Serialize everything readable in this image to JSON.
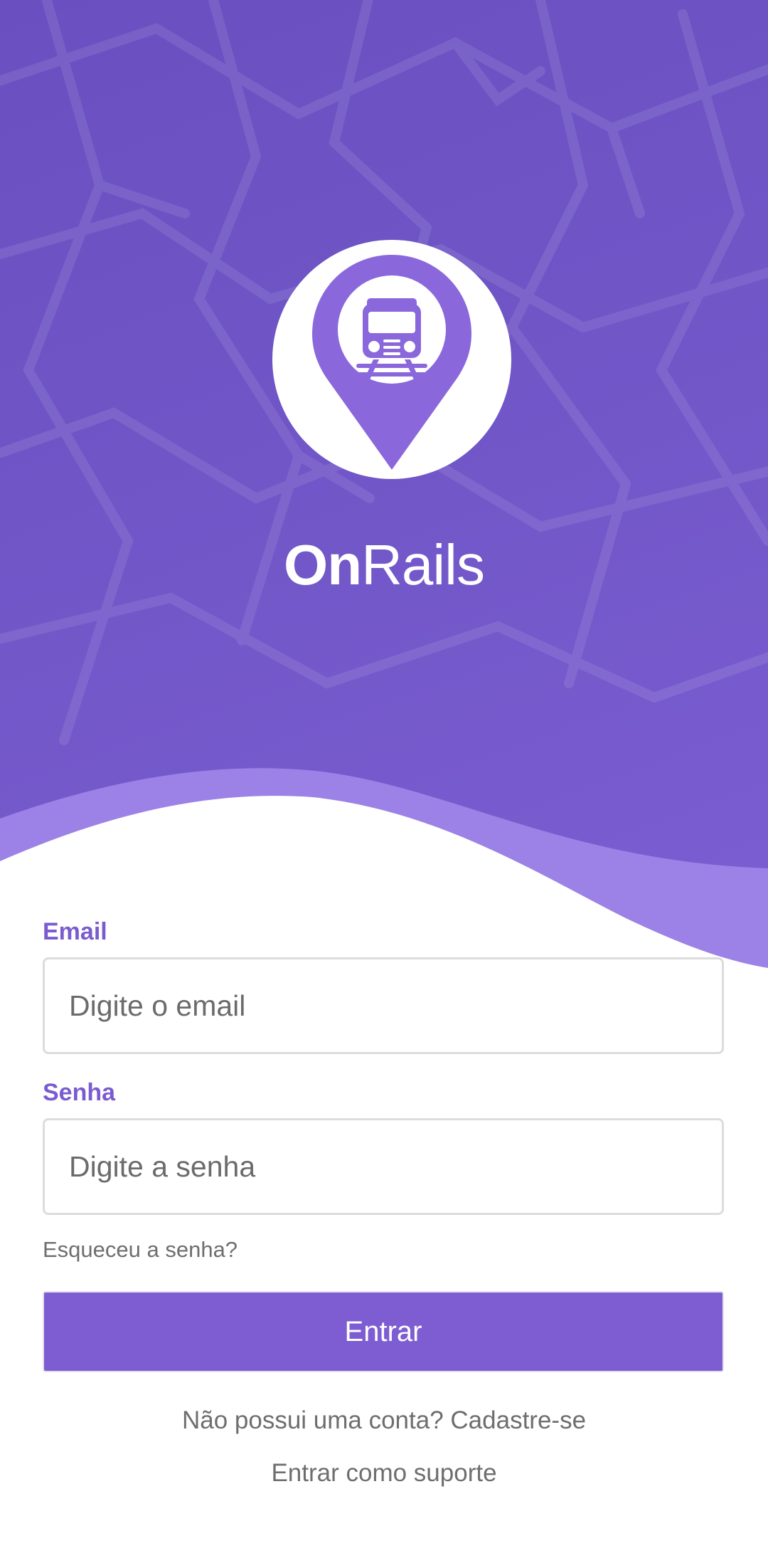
{
  "brand": {
    "part1": "On",
    "part2": "Rails",
    "logo_icon": "train-location-pin-icon",
    "colors": {
      "hero_dark": "#6a4fc0",
      "hero_light": "#7c5fd3",
      "accent": "#7e5cd1",
      "label": "#7b5bd0"
    }
  },
  "form": {
    "email_label": "Email",
    "email_placeholder": "Digite o email",
    "password_label": "Senha",
    "password_placeholder": "Digite a senha",
    "forgot_label": "Esqueceu a senha?",
    "submit_label": "Entrar"
  },
  "footer": {
    "signup_label": "Não possui uma conta? Cadastre-se",
    "support_label": "Entrar como suporte"
  }
}
